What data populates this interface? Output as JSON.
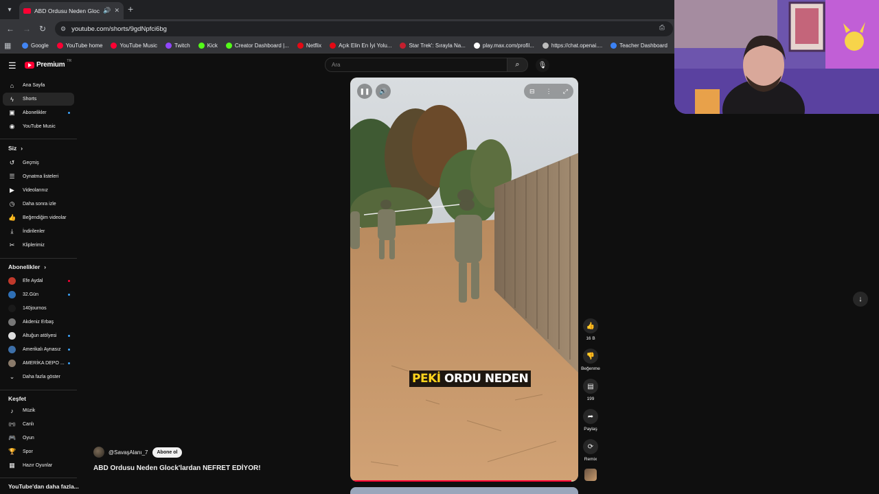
{
  "browser": {
    "tab_title": "ABD Ordusu Neden Glock'la",
    "url": "youtube.com/shorts/9gdNpfci6bg",
    "bookmarks": [
      {
        "label": "Google",
        "color": "#4285f4"
      },
      {
        "label": "YouTube home",
        "color": "#ff0033"
      },
      {
        "label": "YouTube Music",
        "color": "#ff0033"
      },
      {
        "label": "Twitch",
        "color": "#9146ff"
      },
      {
        "label": "Kick",
        "color": "#53fc18"
      },
      {
        "label": "Creator Dashboard |...",
        "color": "#53fc18"
      },
      {
        "label": "Netflix",
        "color": "#e50914"
      },
      {
        "label": "Açık Elin En İyi Yolu...",
        "color": "#e50914"
      },
      {
        "label": "Star Trek': Sırayla Na...",
        "color": "#c41f2e"
      },
      {
        "label": "play.max.com/profil...",
        "color": "#ffffff"
      },
      {
        "label": "https://chat.openai....",
        "color": "#bdbdbd"
      },
      {
        "label": "Teacher Dashboard",
        "color": "#3b82f6"
      }
    ]
  },
  "masthead": {
    "brand": "Premium",
    "country_code": "TR",
    "search_placeholder": "Ara"
  },
  "sidebar": {
    "main": [
      {
        "label": "Ana Sayfa",
        "icon": "home-icon"
      },
      {
        "label": "Shorts",
        "icon": "shorts-icon",
        "active": true
      },
      {
        "label": "Abonelikler",
        "icon": "subscriptions-icon"
      },
      {
        "label": "YouTube Music",
        "icon": "youtube-music-icon"
      }
    ],
    "you_header": "Siz",
    "you": [
      {
        "label": "Geçmiş",
        "icon": "history-icon"
      },
      {
        "label": "Oynatma listeleri",
        "icon": "playlists-icon"
      },
      {
        "label": "Videolarınız",
        "icon": "your-videos-icon"
      },
      {
        "label": "Daha sonra izle",
        "icon": "watch-later-icon"
      },
      {
        "label": "Beğendiğim videolar",
        "icon": "liked-videos-icon"
      },
      {
        "label": "İndirilenler",
        "icon": "downloads-icon"
      },
      {
        "label": "Kliplerimiz",
        "icon": "clips-icon"
      }
    ],
    "subs_header": "Abonelikler",
    "subscriptions": [
      {
        "label": "Efe Aydal",
        "color": "#c0392b",
        "badge": "live"
      },
      {
        "label": "32.Gün",
        "color": "#2e6fb5",
        "badge": "new"
      },
      {
        "label": "140journos",
        "color": "#1a1a1a",
        "badge": ""
      },
      {
        "label": "Akdeniz Erbaş",
        "color": "#777777",
        "badge": ""
      },
      {
        "label": "Altuğun atölyesi",
        "color": "#dddddd",
        "badge": "new"
      },
      {
        "label": "Amerikalı Aynasız",
        "color": "#3d6fa8",
        "badge": "new"
      },
      {
        "label": "AMERİKA DEPO ...",
        "color": "#8a7a6a",
        "badge": "new"
      }
    ],
    "show_more": "Daha fazla göster",
    "explore_header": "Keşfet",
    "explore": [
      {
        "label": "Müzik",
        "icon": "music-icon"
      },
      {
        "label": "Canlı",
        "icon": "live-icon"
      },
      {
        "label": "Oyun",
        "icon": "gaming-icon"
      },
      {
        "label": "Spor",
        "icon": "trophy-icon"
      },
      {
        "label": "Hazır Oyunlar",
        "icon": "playables-icon"
      }
    ],
    "more_header": "YouTube'dan daha fazla..."
  },
  "short": {
    "caption_highlight": "PEKİ",
    "caption_rest": "ORDU NEDEN",
    "progress": 0.97,
    "channel": "@SavaşAlanı_7",
    "subscribe": "Abone ol",
    "title": "ABD Ordusu Neden Glock'lardan NEFRET EDİYOR!"
  },
  "actions": {
    "likes": "16 B",
    "dislike": "Beğenme",
    "comments": "199",
    "share": "Paylaş",
    "remix": "Remix"
  }
}
